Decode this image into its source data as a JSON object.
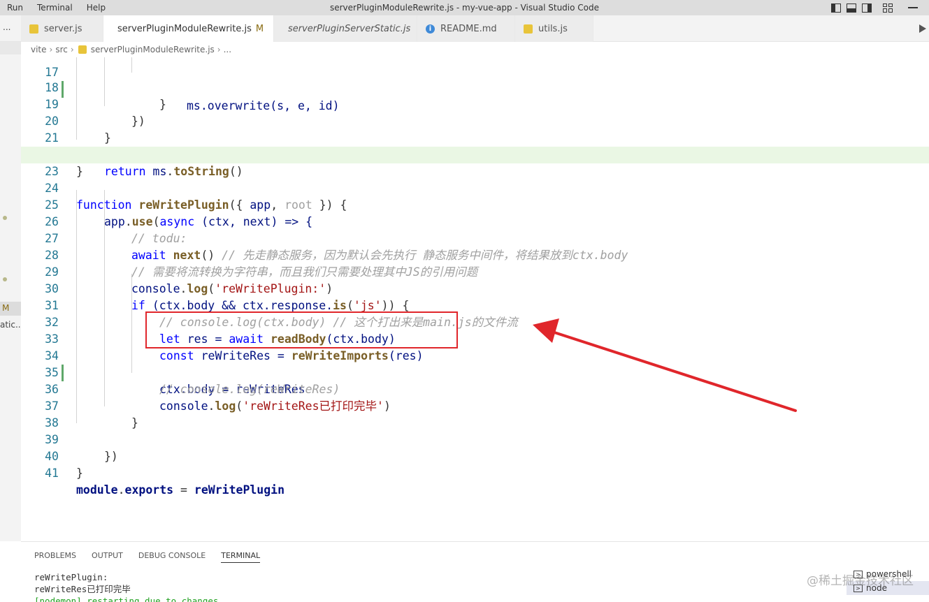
{
  "titlebar": {
    "menu": [
      "Run",
      "Terminal",
      "Help"
    ],
    "title": "serverPluginModuleRewrite.js - my-vue-app - Visual Studio Code"
  },
  "tabs": {
    "ellipsis": "...",
    "items": [
      {
        "label": "server.js",
        "icon": "js-file-icon"
      },
      {
        "label": "serverPluginModuleRewrite.js",
        "modified": "M",
        "icon": "js-file-icon"
      },
      {
        "label": "serverPluginServerStatic.js",
        "icon": "js-file-icon"
      },
      {
        "label": "README.md",
        "icon": "info-icon"
      },
      {
        "label": "utils.js",
        "icon": "js-file-icon"
      }
    ]
  },
  "breadcrumb": {
    "parts": [
      "vite",
      "src",
      "serverPluginModuleRewrite.js",
      "..."
    ]
  },
  "sidebar": {
    "modified_badge": "M",
    "truncated_item": "atic..."
  },
  "editor": {
    "line_numbers": [
      "17",
      "18",
      "19",
      "20",
      "21",
      "22",
      "23",
      "24",
      "25",
      "26",
      "27",
      "28",
      "29",
      "30",
      "31",
      "32",
      "33",
      "34",
      "35",
      "36",
      "37",
      "38",
      "39",
      "40",
      "41"
    ],
    "tokens": {
      "l17": "ms.overwrite(s, e, id)",
      "l18": "}",
      "l19": "})",
      "l20": "}",
      "l21_kw": "return",
      "l21_id": "ms",
      "l21_fn": "toString",
      "l21_rest": "()",
      "l22": "}",
      "l24_kw": "function",
      "l24_fn": "reWritePlugin",
      "l24_a": "({",
      "l24_app": "app",
      "l24_comma": ",",
      "l24_root": "root",
      "l24_b": "}) {",
      "l25_id": "app",
      "l25_fn": "use",
      "l25_a": "(",
      "l25_kw": "async",
      "l25_b": "(ctx, next) => {",
      "l26": "// todu:",
      "l27_kw": "await",
      "l27_fn": "next",
      "l27_paren": "()",
      "l27_cm": "// 先走静态服务，因为默认会先执行 静态服务中间件，将结果放到ctx.body",
      "l28": "// 需要将流转换为字符串，而且我们只需要处理其中JS的引用问题",
      "l29_id": "console",
      "l29_fn": "log",
      "l29_str": "'reWritePlugin:'",
      "l30_kw": "if",
      "l30_a": "(ctx.body && ctx.response.",
      "l30_fn": "is",
      "l30_str": "'js'",
      "l30_b": ")) {",
      "l31": "// console.log(ctx.body) // 这个打出来是main.js的文件流",
      "l32_kw": "let",
      "l32_a": "res =",
      "l32_kw2": "await",
      "l32_fn": "readBody",
      "l32_b": "(ctx.body)",
      "l33_kw": "const",
      "l33_a": "reWriteRes =",
      "l33_fn": "reWriteImports",
      "l33_b": "(res)",
      "l34": "ctx.body = reWriteRes",
      "l35": "// console.log(reWriteRes)",
      "l36_id": "console",
      "l36_fn": "log",
      "l36_str": "'reWriteRes已打印完毕'",
      "l37": "}",
      "l39": "})",
      "l40": "}",
      "l41_kw": "module",
      "l41_fn": "exports",
      "l41_eq": "=",
      "l41_id": "reWritePlugin"
    }
  },
  "panel": {
    "tabs": [
      "PROBLEMS",
      "OUTPUT",
      "DEBUG CONSOLE",
      "TERMINAL"
    ],
    "active_tab": "TERMINAL",
    "terminal_lines": [
      "reWritePlugin:",
      "reWriteRes已打印完毕",
      "[nodemon] restarting due to changes..."
    ],
    "terminals": [
      "powershell",
      "node"
    ]
  },
  "watermark": "@稀土掘金技术社区",
  "colors": {
    "annotation_red": "#e0262b",
    "keyword": "#0000ff",
    "function": "#795e26",
    "string": "#a31515",
    "comment": "#a0a0a0"
  }
}
